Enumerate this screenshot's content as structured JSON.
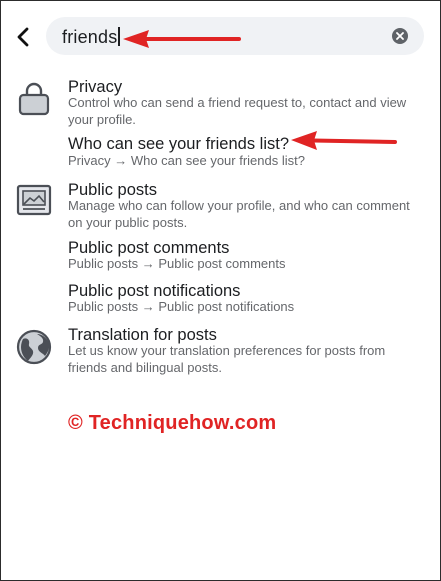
{
  "search": {
    "query": "friends"
  },
  "results": [
    {
      "title": "Privacy",
      "subtitle": "Control who can send a friend request to, contact and view your profile.",
      "icon": "lock-icon"
    },
    {
      "title": "Who can see your friends list?",
      "subtitle": "Privacy → Who can see your friends list?"
    },
    {
      "title": "Public posts",
      "subtitle": "Manage who can follow your profile, and who can comment on your public posts.",
      "icon": "public-posts-icon"
    },
    {
      "title": "Public post comments",
      "subtitle": "Public posts → Public post comments"
    },
    {
      "title": "Public post notifications",
      "subtitle": "Public posts → Public post notifications"
    },
    {
      "title": "Translation for posts",
      "subtitle": "Let us know your translation preferences for posts from friends and bilingual posts.",
      "icon": "globe-icon"
    }
  ],
  "watermark": "© Techniquehow.com",
  "colors": {
    "annotation_arrow": "#e02424",
    "search_background": "#f0f2f5",
    "secondary_text": "#65676b"
  }
}
